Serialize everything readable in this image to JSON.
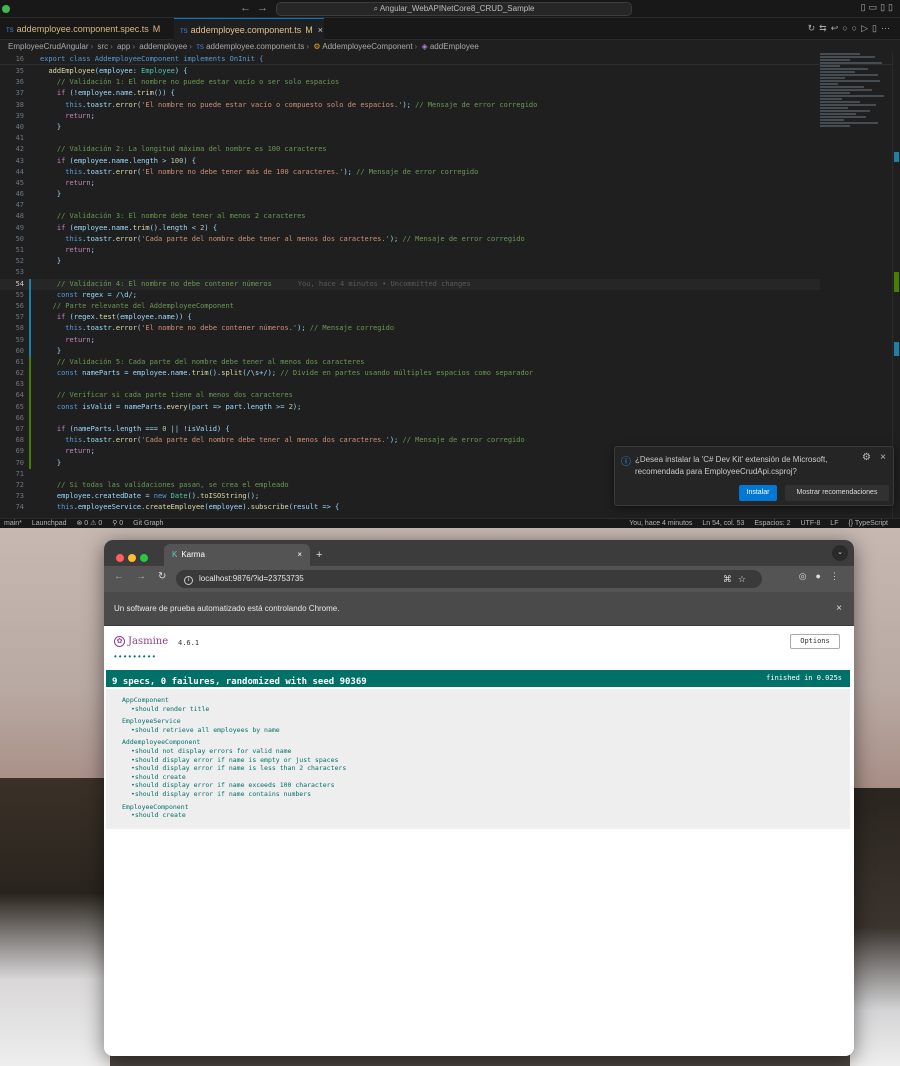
{
  "vscode": {
    "title_search": "Angular_WebAPINetCore8_CRUD_Sample",
    "tabs": [
      {
        "label": "addemployee.component.spec.ts",
        "status": "M"
      },
      {
        "label": "addemployee.component.ts",
        "status": "M"
      }
    ],
    "breadcrumb": [
      "EmployeeCrudAngular",
      "src",
      "app",
      "addemployee",
      "addemployee.component.ts",
      "AddemployeeComponent",
      "addEmployee"
    ],
    "sticky": {
      "num": "16",
      "text": "export class AddemployeeComponent implements OnInit {"
    },
    "blame": "You, hace 4 minutos • Uncommitted changes",
    "notification": {
      "message": "¿Desea instalar la 'C# Dev Kit' extensión de Microsoft, recomendada para EmployeeCrudApi.csproj?",
      "install": "Instalar",
      "recommendations": "Mostrar recomendaciones"
    },
    "status": {
      "branch": "main*",
      "launchpad": "Launchpad",
      "problems": "⊗ 0 ⚠ 0",
      "ports": "⚲ 0",
      "git_graph": "Git Graph",
      "blame": "You, hace 4 minutos",
      "position": "Ln 54, col. 53",
      "spaces": "Espacios: 2",
      "encoding": "UTF-8",
      "eol": "LF",
      "language": "{} TypeScript"
    }
  },
  "chrome": {
    "tab_title": "Karma",
    "url": "localhost:9876/?id=23753735",
    "infobar": "Un software de prueba automatizado está controlando Chrome.",
    "jasmine": {
      "brand": "Jasmine",
      "version": "4.6.1",
      "dots": "•••••••••",
      "options": "Options",
      "summary": "9 specs, 0 failures, randomized with seed 90369",
      "finished": "finished in 0.025s",
      "suites": [
        {
          "name": "AppComponent",
          "specs": [
            "should render title"
          ]
        },
        {
          "name": "EmployeeService",
          "specs": [
            "should retrieve all employees by name"
          ]
        },
        {
          "name": "AddemployeeComponent",
          "specs": [
            "should not display errors for valid name",
            "should display error if name is empty or just spaces",
            "should display error if name is less than 2 characters",
            "should create",
            "should display error if name exceeds 100 characters",
            "should display error if name contains numbers"
          ]
        },
        {
          "name": "EmployeeComponent",
          "specs": [
            "should create"
          ]
        }
      ]
    }
  },
  "colors": {
    "accent": "#0078d4",
    "jasmine_green": "#007069",
    "jasmine_purple": "#8a4182"
  },
  "code": [
    {
      "n": "35",
      "t": "  addEmployee(employee: Employee) {"
    },
    {
      "n": "36",
      "t": "    // Validación 1: El nombre no puede estar vacío o ser solo espacios"
    },
    {
      "n": "37",
      "t": "    if (!employee.name.trim()) {"
    },
    {
      "n": "38",
      "t": "      this.toastr.error('El nombre no puede estar vacío o compuesto solo de espacios.'); // Mensaje de error corregido"
    },
    {
      "n": "39",
      "t": "      return;"
    },
    {
      "n": "40",
      "t": "    }"
    },
    {
      "n": "41",
      "t": ""
    },
    {
      "n": "42",
      "t": "    // Validación 2: La longitud máxima del nombre es 100 caracteres"
    },
    {
      "n": "43",
      "t": "    if (employee.name.length > 100) {"
    },
    {
      "n": "44",
      "t": "      this.toastr.error('El nombre no debe tener más de 100 caracteres.'); // Mensaje de error corregido"
    },
    {
      "n": "45",
      "t": "      return;"
    },
    {
      "n": "46",
      "t": "    }"
    },
    {
      "n": "47",
      "t": ""
    },
    {
      "n": "48",
      "t": "    // Validación 3: El nombre debe tener al menos 2 caracteres"
    },
    {
      "n": "49",
      "t": "    if (employee.name.trim().length < 2) {"
    },
    {
      "n": "50",
      "t": "      this.toastr.error('Cada parte del nombre debe tener al menos dos caracteres.'); // Mensaje de error corregido"
    },
    {
      "n": "51",
      "t": "      return;"
    },
    {
      "n": "52",
      "t": "    }"
    },
    {
      "n": "53",
      "t": ""
    },
    {
      "n": "54",
      "t": "    // Validación 4: El nombre no debe contener números"
    },
    {
      "n": "55",
      "t": "    const regex = /\\d/;"
    },
    {
      "n": "56",
      "t": "   // Parte relevante del AddemployeeComponent"
    },
    {
      "n": "57",
      "t": "    if (regex.test(employee.name)) {"
    },
    {
      "n": "58",
      "t": "      this.toastr.error('El nombre no debe contener números.'); // Mensaje corregido"
    },
    {
      "n": "59",
      "t": "      return;"
    },
    {
      "n": "60",
      "t": "    }"
    },
    {
      "n": "61",
      "t": "    // Validación 5: Cada parte del nombre debe tener al menos dos caracteres"
    },
    {
      "n": "62",
      "t": "    const nameParts = employee.name.trim().split(/\\s+/); // Divide en partes usando múltiples espacios como separador"
    },
    {
      "n": "63",
      "t": ""
    },
    {
      "n": "64",
      "t": "    // Verificar si cada parte tiene al menos dos caracteres"
    },
    {
      "n": "65",
      "t": "    const isValid = nameParts.every(part => part.length >= 2);"
    },
    {
      "n": "66",
      "t": ""
    },
    {
      "n": "67",
      "t": "    if (nameParts.length === 0 || !isValid) {"
    },
    {
      "n": "68",
      "t": "      this.toastr.error('Cada parte del nombre debe tener al menos dos caracteres.'); // Mensaje de error corregido"
    },
    {
      "n": "69",
      "t": "      return;"
    },
    {
      "n": "70",
      "t": "    }"
    },
    {
      "n": "71",
      "t": ""
    },
    {
      "n": "72",
      "t": "    // Si todas las validaciones pasan, se crea el empleado"
    },
    {
      "n": "73",
      "t": "    employee.createdDate = new Date().toISOString();"
    },
    {
      "n": "74",
      "t": "    this.employeeService.createEmployee(employee).subscribe(result => {"
    }
  ]
}
